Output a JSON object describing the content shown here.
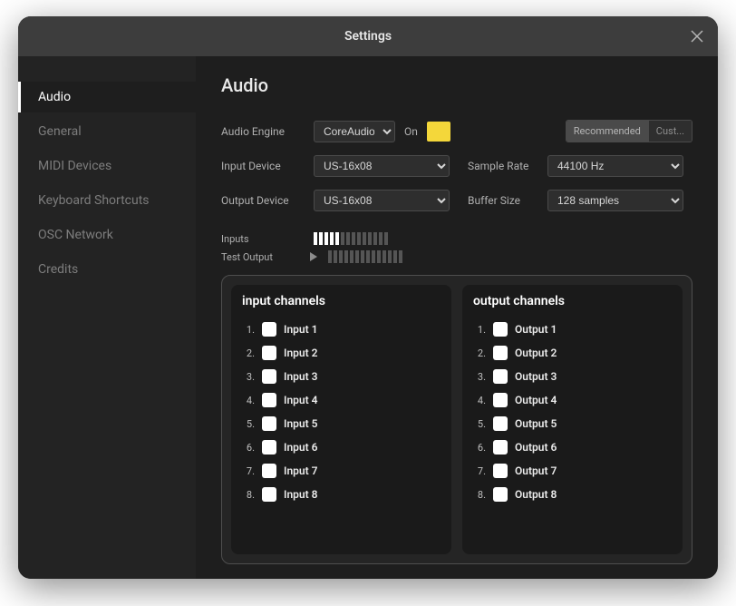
{
  "window": {
    "title": "Settings"
  },
  "sidebar": {
    "items": [
      {
        "label": "Audio",
        "active": true
      },
      {
        "label": "General"
      },
      {
        "label": "MIDI Devices"
      },
      {
        "label": "Keyboard Shortcuts"
      },
      {
        "label": "OSC Network"
      },
      {
        "label": "Credits"
      }
    ]
  },
  "page": {
    "title": "Audio"
  },
  "labels": {
    "audio_engine": "Audio Engine",
    "on": "On",
    "input_device": "Input Device",
    "output_device": "Output Device",
    "sample_rate": "Sample Rate",
    "buffer_size": "Buffer Size",
    "inputs": "Inputs",
    "test_output": "Test Output"
  },
  "engine": {
    "value": "CoreAudio",
    "swatch_color": "#f4d73a"
  },
  "input": {
    "value": "US-16x08"
  },
  "output": {
    "value": "US-16x08"
  },
  "sample_rate": {
    "value": "44100 Hz"
  },
  "buffer": {
    "value": "128 samples"
  },
  "presets": {
    "recommended": "Recommended",
    "custom": "Cust...",
    "active": "recommended"
  },
  "input_meter": {
    "total": 14,
    "active": 5
  },
  "output_meter": {
    "total": 14,
    "active": 0
  },
  "channels": {
    "inputs_title": "input channels",
    "outputs_title": "output channels",
    "inputs": [
      {
        "num": "1.",
        "name": "Input 1"
      },
      {
        "num": "2.",
        "name": "Input 2"
      },
      {
        "num": "3.",
        "name": "Input 3"
      },
      {
        "num": "4.",
        "name": "Input 4"
      },
      {
        "num": "5.",
        "name": "Input 5"
      },
      {
        "num": "6.",
        "name": "Input 6"
      },
      {
        "num": "7.",
        "name": "Input 7"
      },
      {
        "num": "8.",
        "name": "Input 8"
      }
    ],
    "outputs": [
      {
        "num": "1.",
        "name": "Output 1"
      },
      {
        "num": "2.",
        "name": "Output 2"
      },
      {
        "num": "3.",
        "name": "Output 3"
      },
      {
        "num": "4.",
        "name": "Output 4"
      },
      {
        "num": "5.",
        "name": "Output 5"
      },
      {
        "num": "6.",
        "name": "Output 6"
      },
      {
        "num": "7.",
        "name": "Output 7"
      },
      {
        "num": "8.",
        "name": "Output 8"
      }
    ]
  }
}
